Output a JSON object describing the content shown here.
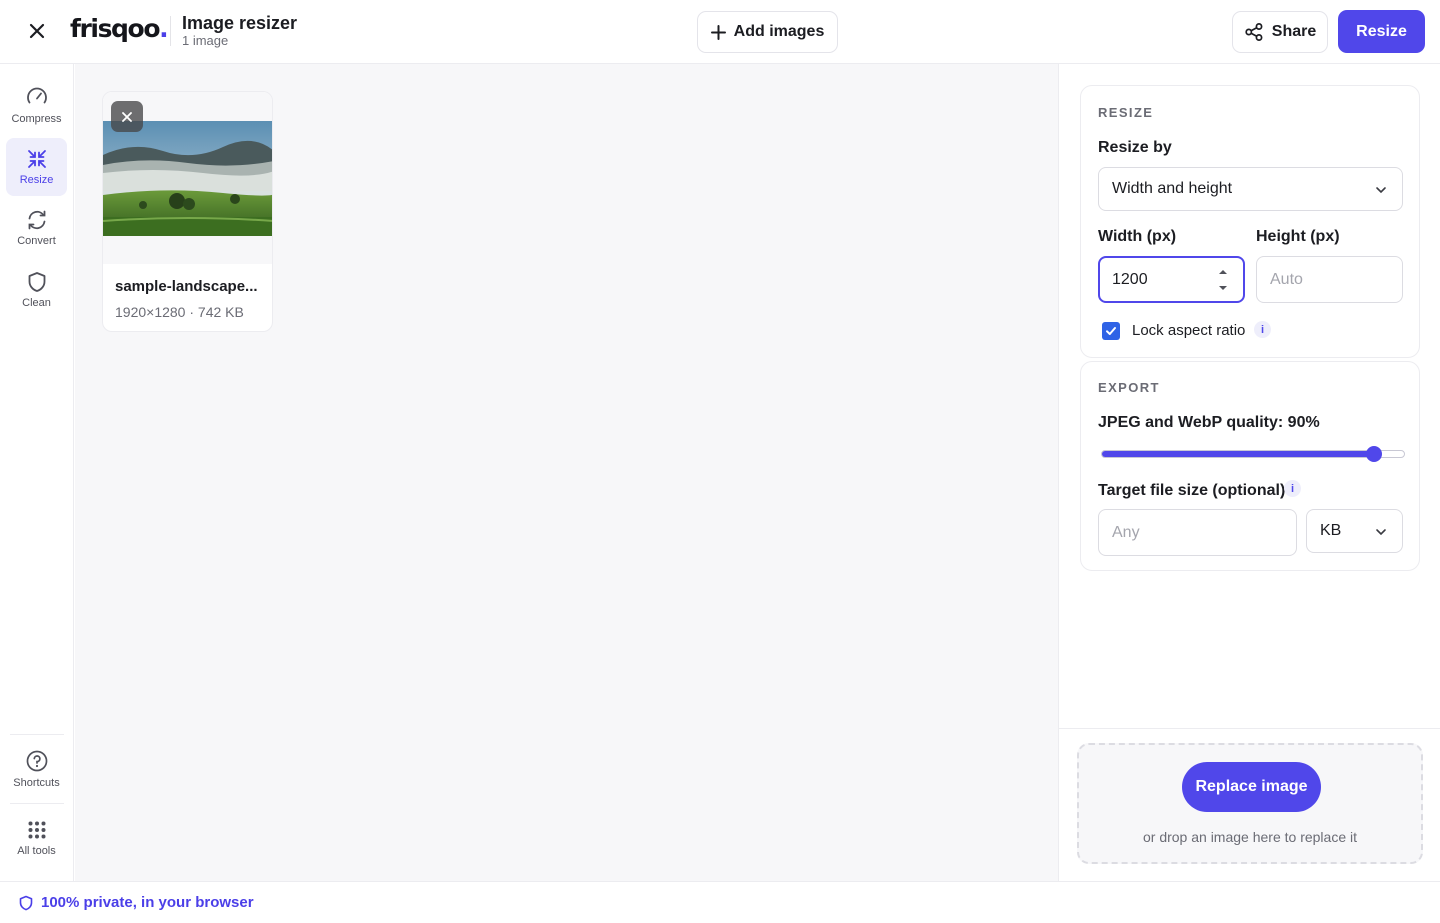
{
  "header": {
    "logo_text": "frisqoo",
    "logo_dot": ".",
    "title": "Image resizer",
    "subtitle": "1 image",
    "add_images_label": "Add images",
    "share_label": "Share",
    "resize_label": "Resize"
  },
  "sidebar": {
    "items": [
      {
        "label": "Compress",
        "icon": "gauge-icon"
      },
      {
        "label": "Resize",
        "icon": "shrink-arrows-icon",
        "active": true
      },
      {
        "label": "Convert",
        "icon": "refresh-icon"
      },
      {
        "label": "Clean",
        "icon": "shield-icon"
      }
    ],
    "bottom": [
      {
        "label": "Shortcuts",
        "icon": "question-circle-icon"
      },
      {
        "label": "All tools",
        "icon": "grid-dots-icon"
      }
    ]
  },
  "canvas": {
    "files": [
      {
        "name": "sample-landscape...",
        "meta": "1920×1280 · 742 KB"
      }
    ]
  },
  "panel": {
    "resize_section": "RESIZE",
    "resize_by_label": "Resize by",
    "resize_by_value": "Width and height",
    "width_label": "Width (px)",
    "width_value": "1200",
    "height_label": "Height (px)",
    "height_placeholder": "Auto",
    "lock_label": "Lock aspect ratio",
    "lock_checked": true,
    "info_glyph": "i",
    "export_section": "EXPORT",
    "quality_label": "JPEG and WebP quality: 90%",
    "quality_value": 0.9,
    "target_label": "Target file size (optional)",
    "target_placeholder": "Any",
    "target_unit": "KB"
  },
  "dropzone": {
    "button_label": "Replace image",
    "hint": "or drop an image here to replace it"
  },
  "footer": {
    "privacy_text": "100% private, in your browser"
  },
  "colors": {
    "accent": "#5047ea",
    "checkbox": "#2f63e6",
    "text": "#1c1d22",
    "muted": "#6b6c75"
  }
}
